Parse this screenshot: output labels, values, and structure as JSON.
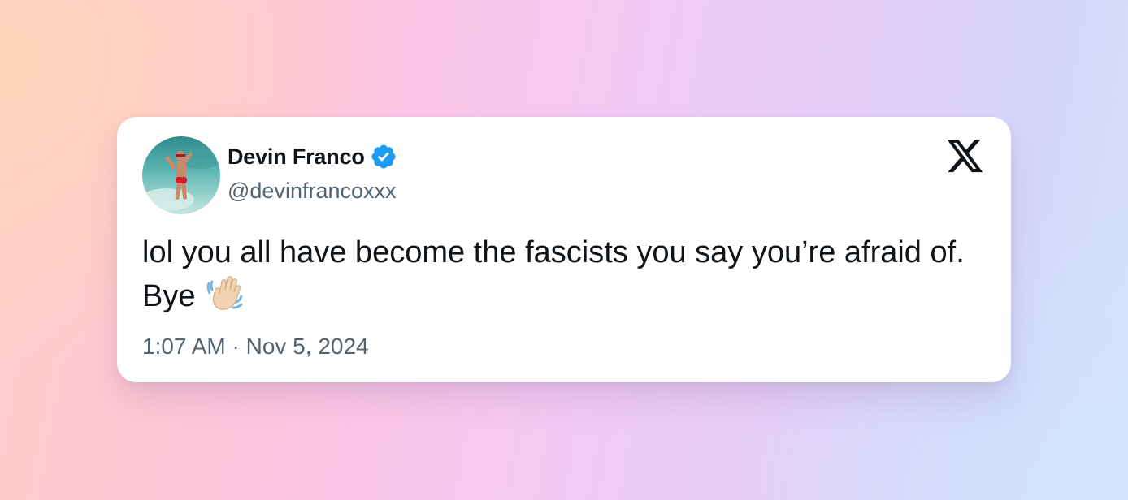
{
  "post": {
    "author": {
      "display_name": "Devin Franco",
      "handle": "@devinfrancoxxx",
      "verified": true,
      "avatar": "profile-photo"
    },
    "text": "lol you all have become the fascists you say you’re afraid of. Bye",
    "emoji": "waving-hand-light-skin-tone",
    "timestamp": "1:07 AM · Nov 5, 2024"
  },
  "icons": {
    "verified": "verified-badge-icon",
    "brand": "x-logo-icon"
  },
  "colors": {
    "verified_badge": "#1d9bf0",
    "name_text": "#0f1419",
    "secondary_text": "#536471",
    "card_background": "#ffffff"
  }
}
